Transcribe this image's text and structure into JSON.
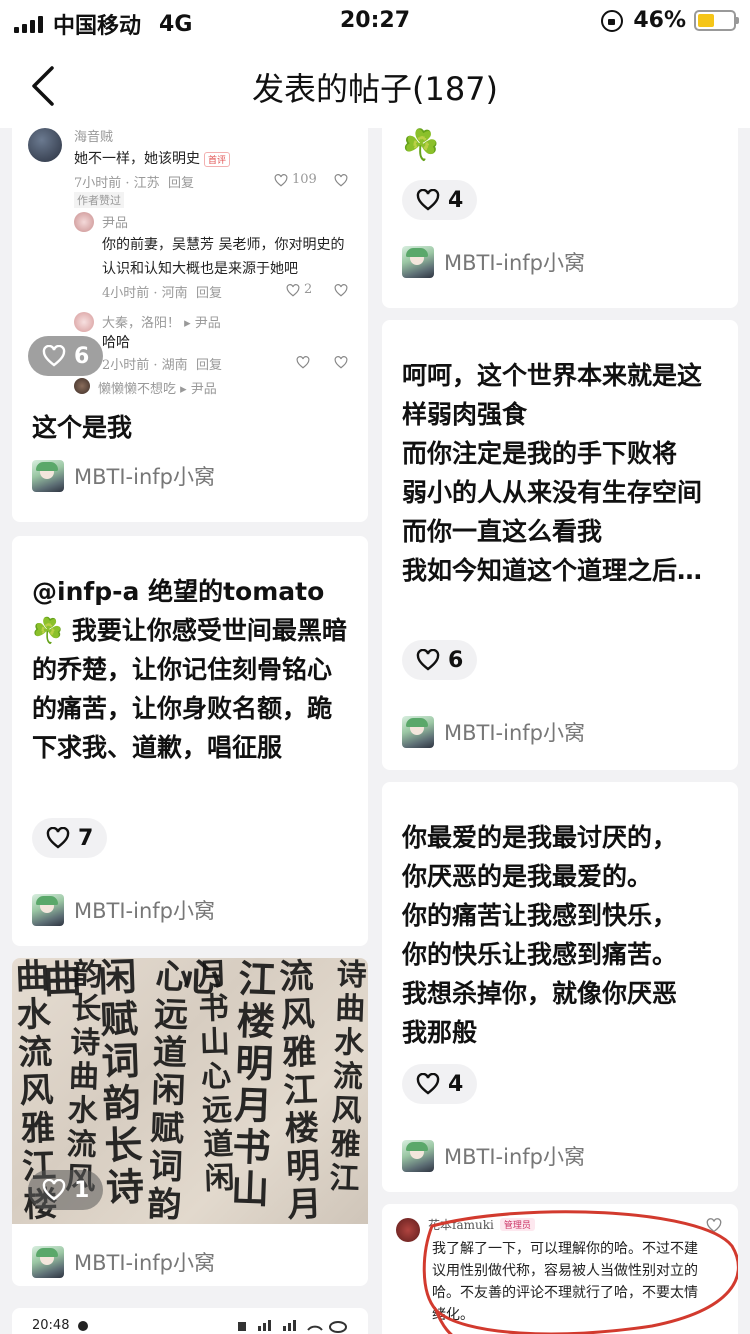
{
  "status_bar": {
    "carrier": "中国移动",
    "network": "4G",
    "time": "20:27",
    "battery_text": "46%",
    "battery_level": 0.46
  },
  "nav": {
    "title": "发表的帖子(187)",
    "back_icon": "chevron-left-icon"
  },
  "author_name": "MBTI-infp小窝",
  "left_column": [
    {
      "id": "c1",
      "screenshot": {
        "top_user": "海音贼",
        "top_text": "她不一样，她该明史",
        "top_meta": "7小时前 · 江苏",
        "top_reply": "回复",
        "top_likes": "109",
        "author_tag": "作者赞过",
        "reply_user": "尹品",
        "reply_line1": "你的前妻，吴慧芳 吴老师，你对明史的",
        "reply_line2": "认识和认知大概也是来源于她吧",
        "reply_meta": "4小时前 · 河南",
        "reply_reply": "回复",
        "reply_likes": "2",
        "sub_user": "大秦，洛阳！ ▸ 尹品",
        "sub_text": "哈哈",
        "sub_meta": "2小时前 · 湖南",
        "sub_reply": "回复",
        "bottom_user": "懒懒懒不想吃 ▸ 尹品",
        "hot_tag": "首评"
      },
      "likes": "6",
      "text": "这个是我"
    },
    {
      "id": "c2",
      "text": "@infp-a 绝望的tomato ☘️ 我要让你感受世间最黑暗的乔楚，让你记住刻骨铭心的痛苦，让你身败名额，跪下求我、道歉，唱征服",
      "likes": "7"
    },
    {
      "id": "c3",
      "likes": "1",
      "image_desc_glyphs": [
        "诗",
        "曲",
        "水",
        "流",
        "风",
        "雅",
        "江",
        "楼",
        "明",
        "月",
        "书",
        "山",
        "心",
        "远",
        "道",
        "闲",
        "赋",
        "词",
        "韵",
        "长"
      ]
    },
    {
      "id": "c4",
      "status_time": "20:48"
    }
  ],
  "right_column": [
    {
      "id": "r1",
      "emoji": "☘️",
      "likes": "4"
    },
    {
      "id": "r2",
      "text": "呵呵，这个世界本来就是这样弱肉强食\n而你注定是我的手下败将\n弱小的人从来没有生存空间\n而你一直这么看我\n我如今知道这个道理之后…",
      "likes": "6"
    },
    {
      "id": "r3",
      "text": "你最爱的是我最讨厌的，\n你厌恶的是我最爱的。\n你的痛苦让我感到快乐，\n你的快乐让我感到痛苦。\n我想杀掉你，就像你厌恶\n我那般",
      "likes": "4"
    },
    {
      "id": "r4",
      "reply_user": "花本famuki",
      "reply_tag": "管理员",
      "reply_text": "我了解了一下，可以理解你的哈。不过不建议用性别做代称，容易被人当做性别对立的哈。不友善的评论不理就行了哈，不要太情绪化。"
    }
  ]
}
